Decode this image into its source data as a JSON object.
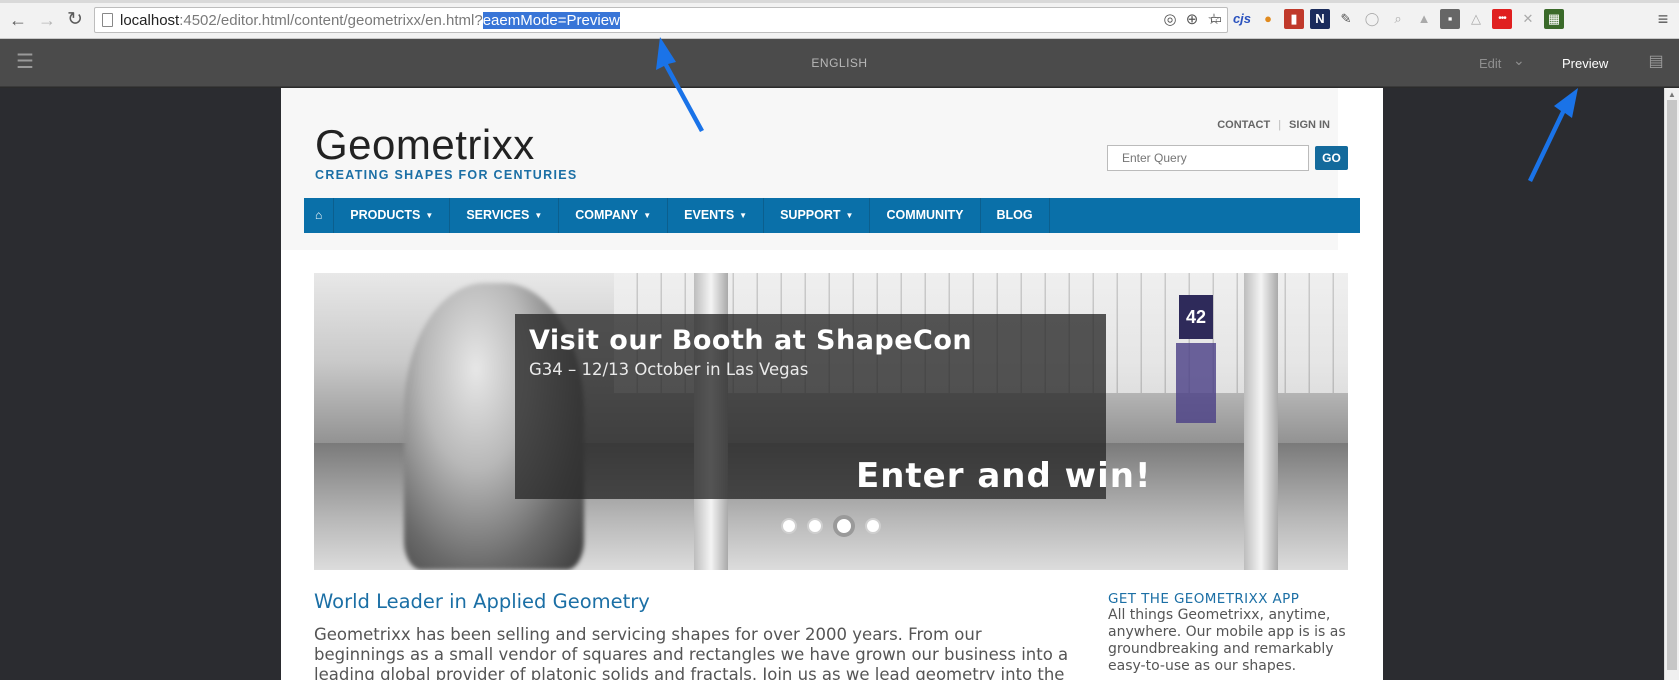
{
  "browser": {
    "url_host": "localhost",
    "url_rest": ":4502/editor.html/content/geometrixx/en.html?",
    "url_selected": "eaemMode=Preview",
    "extensions": [
      "cast-icon",
      "cjs",
      "cookie-icon",
      "book-icon",
      "N",
      "feather-icon",
      "circle-icon",
      "search-icon",
      "angular-icon",
      "square-icon",
      "drive-icon",
      "•••",
      "tool-icon",
      "image-icon"
    ]
  },
  "aem_toolbar": {
    "language": "ENGLISH",
    "mode_edit": "Edit",
    "mode_preview": "Preview"
  },
  "site": {
    "logo_word": "Geometrixx",
    "logo_tagline": "CREATING SHAPES FOR CENTURIES",
    "contact": "CONTACT",
    "separator": "|",
    "sign_in": "SIGN IN",
    "search_placeholder": "Enter Query",
    "go": "GO",
    "nav": [
      {
        "label": "PRODUCTS",
        "caret": "▼"
      },
      {
        "label": "SERVICES",
        "caret": "▼"
      },
      {
        "label": "COMPANY",
        "caret": "▼"
      },
      {
        "label": "EVENTS",
        "caret": "▼"
      },
      {
        "label": "SUPPORT",
        "caret": "▼"
      },
      {
        "label": "COMMUNITY",
        "caret": ""
      },
      {
        "label": "BLOG",
        "caret": ""
      }
    ],
    "hero": {
      "headline": "Visit our Booth at ShapeCon",
      "sub": "G34 – 12/13 October in Las Vegas",
      "cta": "Enter and win!",
      "sign": "42",
      "slide_count": 4,
      "active_slide": 3
    },
    "main_title": "World Leader in Applied Geometry",
    "main_body": "Geometrixx has been selling and servicing shapes for over 2000 years. From our beginnings as a small vendor of squares and rectangles we have grown our business into a leading global provider of platonic solids and fractals. Join us as we lead geometry into the future.",
    "aside_title": "GET THE GEOMETRIXX APP",
    "aside_body": "All things Geometrixx, anytime, anywhere. Our mobile app is is as groundbreaking and remarkably easy-to-use as our shapes."
  },
  "colors": {
    "nav_blue": "#0a70a9",
    "accent_blue": "#1b6fa5",
    "annotation_arrow": "#1a73e8",
    "aem_toolbar": "#4b4b4b"
  }
}
